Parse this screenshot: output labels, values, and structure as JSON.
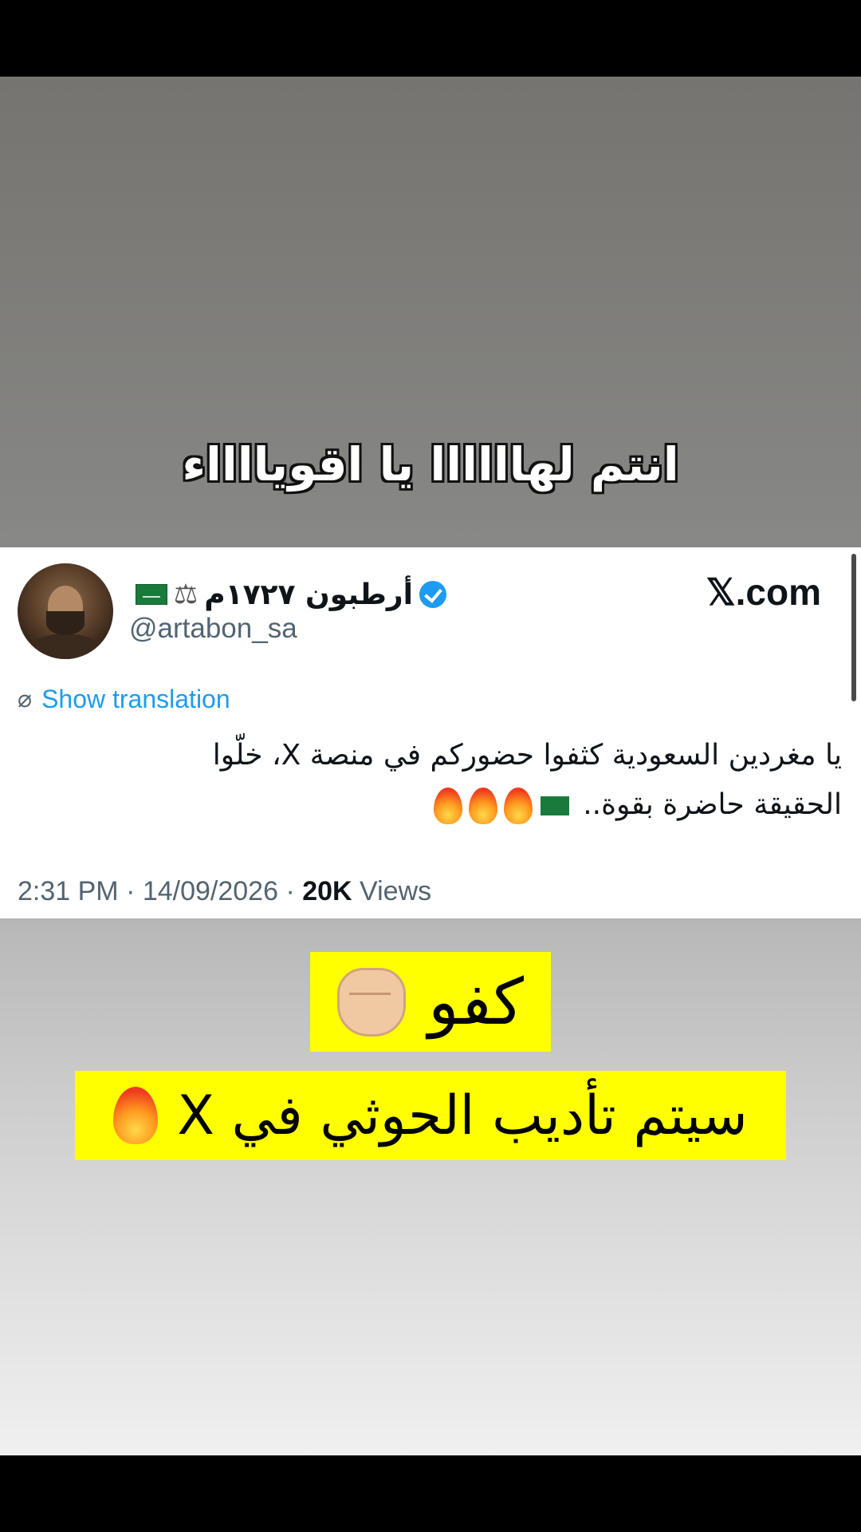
{
  "caption_top": "انتم لهاااااا يا اقويااااء",
  "tweet": {
    "display_name": "أرطبون ۱۷۲۷م",
    "handle": "@artabon_sa",
    "brand": "𝕏.com",
    "show_translation": "Show translation",
    "text_line1": "يا مغردين السعودية كثفوا حضوركم في منصة X، خلّوا",
    "text_line2": "الحقيقة حاضرة بقوة..",
    "timestamp": "2:31 PM · 14/09/2026 · ",
    "views_count": "20K",
    "views_label": " Views"
  },
  "overlay": {
    "line1": "كفو",
    "line2": "سيتم تأديب الحوثي في X"
  },
  "colors": {
    "highlight": "#ffff00",
    "link_blue": "#1d9bf0",
    "verified_blue": "#1d9bf0"
  },
  "icons": [
    "verified-badge-icon",
    "scale-icon",
    "saudi-flag-icon",
    "translate-icon",
    "fire-icon",
    "fist-icon"
  ]
}
